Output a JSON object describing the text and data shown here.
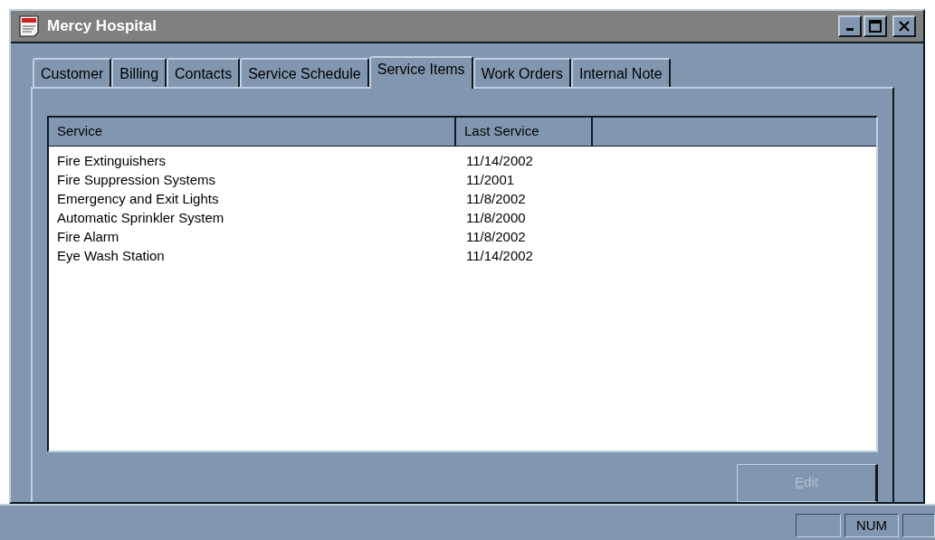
{
  "window": {
    "title": "Mercy Hospital"
  },
  "tabs": [
    {
      "label": "Customer",
      "selected": false
    },
    {
      "label": "Billing",
      "selected": false
    },
    {
      "label": "Contacts",
      "selected": false
    },
    {
      "label": "Service Schedule",
      "selected": false
    },
    {
      "label": "Service Items",
      "selected": true
    },
    {
      "label": "Work Orders",
      "selected": false
    },
    {
      "label": "Internal Note",
      "selected": false
    }
  ],
  "table": {
    "columns": [
      "Service",
      "Last Service"
    ],
    "rows": [
      [
        "Fire Extinguishers",
        "11/14/2002"
      ],
      [
        "Fire Suppression Systems",
        "11/2001"
      ],
      [
        "Emergency and Exit Lights",
        "11/8/2002"
      ],
      [
        "Automatic Sprinkler System",
        "11/8/2000"
      ],
      [
        "Fire Alarm",
        "11/8/2002"
      ],
      [
        "Eye Wash Station",
        "11/14/2002"
      ]
    ]
  },
  "edit_button": {
    "label": "Edit",
    "disabled": true
  },
  "status_bar": {
    "num_indicator": "NUM"
  }
}
